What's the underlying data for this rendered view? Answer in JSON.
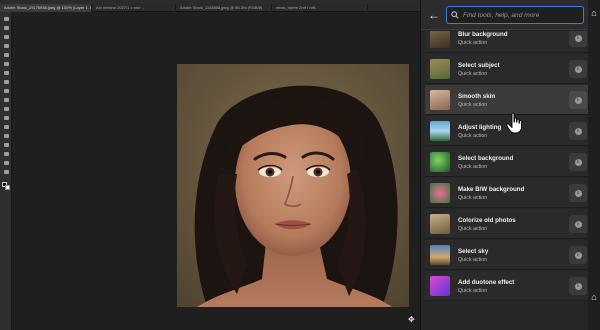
{
  "tabs": [
    {
      "label": "Adobe Stock_29176938.jpeg @ 100% (Layer 1, RGB/8*) *",
      "active": true
    },
    {
      "label": "Arc ntrrnrrz 2027/1 x nrvr ..",
      "active": false
    },
    {
      "label": "Adobe Stock_1143808.jpeg @ 56.3% (RGB/8)",
      "active": false
    },
    {
      "label": "rebrn_nnrrtn 2nrf f nrff..",
      "active": false
    }
  ],
  "search": {
    "placeholder": "Find tools, help, and more"
  },
  "actions": [
    {
      "title": "Blur background",
      "subtitle": "Quick action",
      "thumb": "t1"
    },
    {
      "title": "Select subject",
      "subtitle": "Quick action",
      "thumb": "t2"
    },
    {
      "title": "Smooth skin",
      "subtitle": "Quick action",
      "thumb": "t3"
    },
    {
      "title": "Adjust lighting",
      "subtitle": "Quick action",
      "thumb": "t4"
    },
    {
      "title": "Select background",
      "subtitle": "Quick action",
      "thumb": "t5"
    },
    {
      "title": "Make B/W background",
      "subtitle": "Quick action",
      "thumb": "t6"
    },
    {
      "title": "Colorize old photos",
      "subtitle": "Quick action",
      "thumb": "t7"
    },
    {
      "title": "Select sky",
      "subtitle": "Quick action",
      "thumb": "t8"
    },
    {
      "title": "Add duotone effect",
      "subtitle": "Quick action",
      "thumb": "t9"
    }
  ],
  "hovered_index": 2,
  "icons": {
    "back": "back-arrow-icon",
    "search": "search-icon",
    "info": "info-icon",
    "home": "home-icon",
    "cursor": "hand-pointer-icon"
  },
  "colors": {
    "accent": "#3d7be8",
    "panel_bg": "#262626",
    "canvas_bg": "#1f1f1f"
  }
}
